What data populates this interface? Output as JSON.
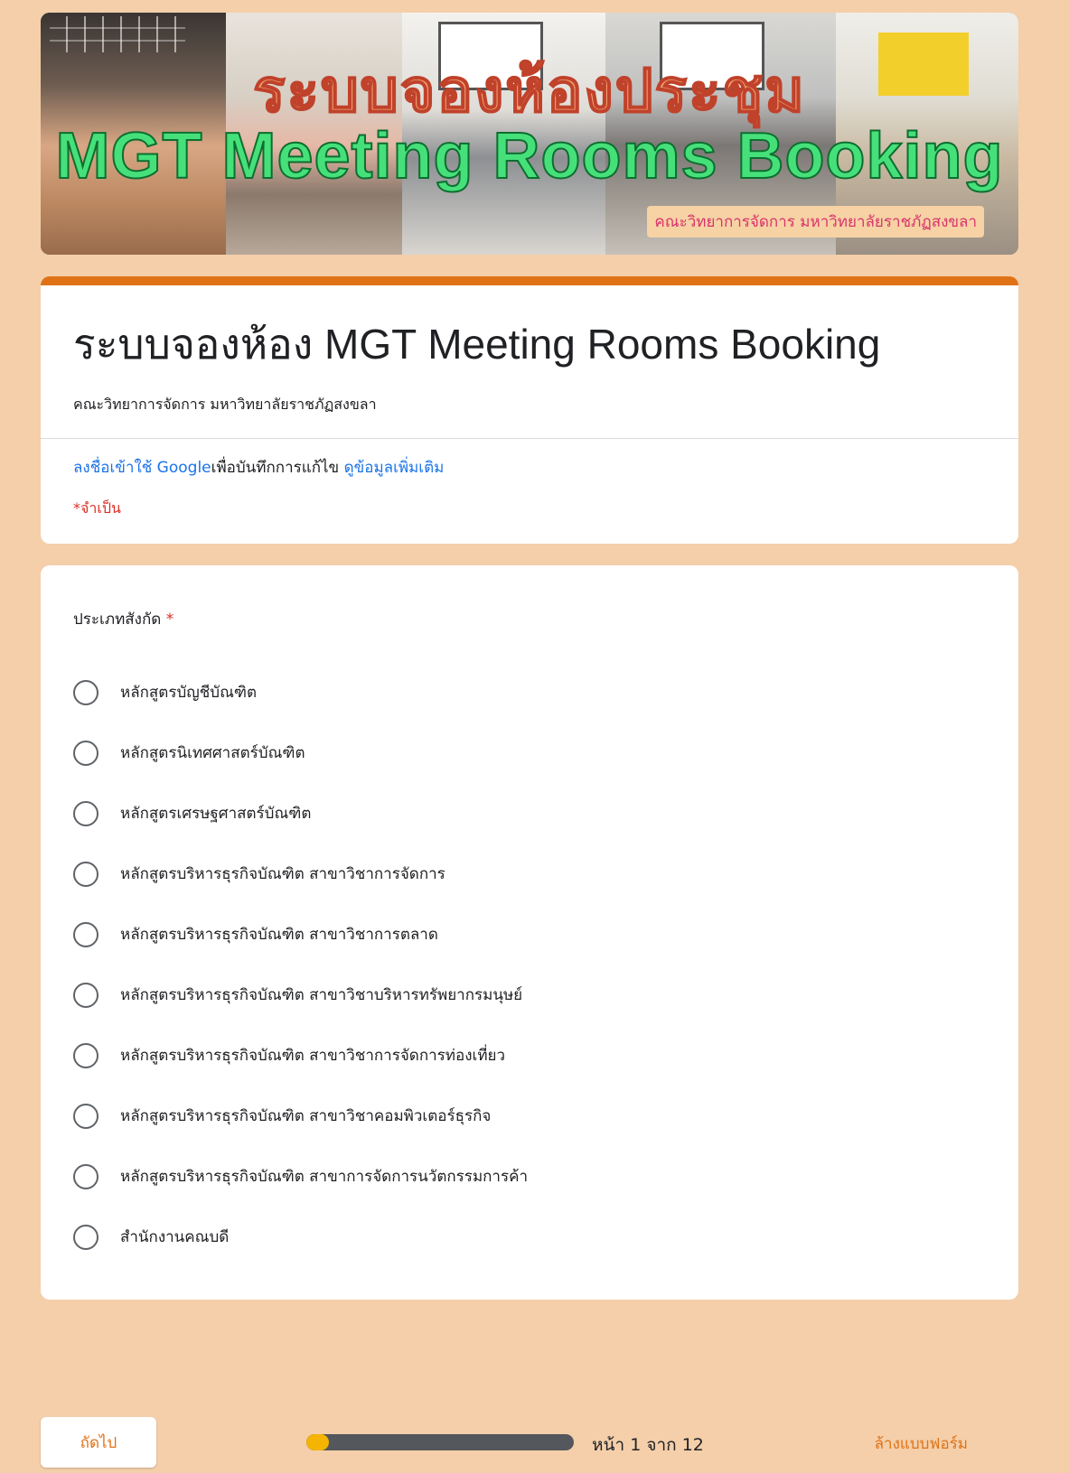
{
  "banner": {
    "title_th": "ระบบจองห้องประชุม",
    "title_en": "MGT Meeting Rooms Booking",
    "subtitle": "คณะวิทยาการจัดการ มหาวิทยาลัยราชภัฏสงขลา"
  },
  "header": {
    "title": "ระบบจองห้อง MGT Meeting Rooms Booking",
    "description": "คณะวิทยาการจัดการ มหาวิทยาลัยราชภัฏสงขลา",
    "signin_link": "ลงชื่อเข้าใช้ Google",
    "signin_text": "เพื่อบันทึกการแก้ไข",
    "more_info_link": "ดูข้อมูลเพิ่มเติม",
    "required_note": "*จำเป็น"
  },
  "question": {
    "title": "ประเภทสังกัด",
    "required_mark": "*",
    "options": [
      "หลักสูตรบัญชีบัณฑิต",
      "หลักสูตรนิเทศศาสตร์บัณฑิต",
      "หลักสูตรเศรษฐศาสตร์บัณฑิต",
      "หลักสูตรบริหารธุรกิจบัณฑิต สาขาวิชาการจัดการ",
      "หลักสูตรบริหารธุรกิจบัณฑิต สาขาวิชาการตลาด",
      "หลักสูตรบริหารธุรกิจบัณฑิต สาขาวิชาบริหารทรัพยากรมนุษย์",
      "หลักสูตรบริหารธุรกิจบัณฑิต สาขาวิชาการจัดการท่องเที่ยว",
      "หลักสูตรบริหารธุรกิจบัณฑิต สาขาวิชาคอมพิวเตอร์ธุรกิจ",
      "หลักสูตรบริหารธุรกิจบัณฑิต สาขาการจัดการนวัตกรรมการค้า",
      "สำนักงานคณบดี"
    ]
  },
  "footer": {
    "next_label": "ถัดไป",
    "page_indicator": "หน้า 1 จาก 12",
    "progress_fraction": 0.0833,
    "clear_label": "ล้างแบบฟอร์ม"
  },
  "colors": {
    "background": "#f4cfaa",
    "accent": "#e07216",
    "link": "#1a73e8",
    "required": "#d93025",
    "progress_fill": "#f4b400"
  }
}
